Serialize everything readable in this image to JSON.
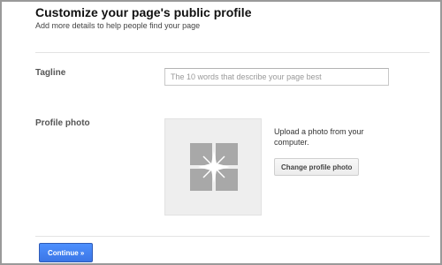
{
  "header": {
    "title": "Customize your page's public profile",
    "subtitle": "Add more details to help people find your page"
  },
  "tagline": {
    "label": "Tagline",
    "value": "",
    "placeholder": "The 10 words that describe your page best"
  },
  "profile_photo": {
    "label": "Profile photo",
    "placeholder_icon": "photo-placeholder-icon",
    "upload_text": "Upload a photo from your computer.",
    "change_button_label": "Change profile photo"
  },
  "footer": {
    "continue_label": "Continue »"
  },
  "colors": {
    "primary_button": "#4d90fe",
    "placeholder_tile": "#a8a8a8",
    "photo_box_background": "#eeeeee"
  }
}
